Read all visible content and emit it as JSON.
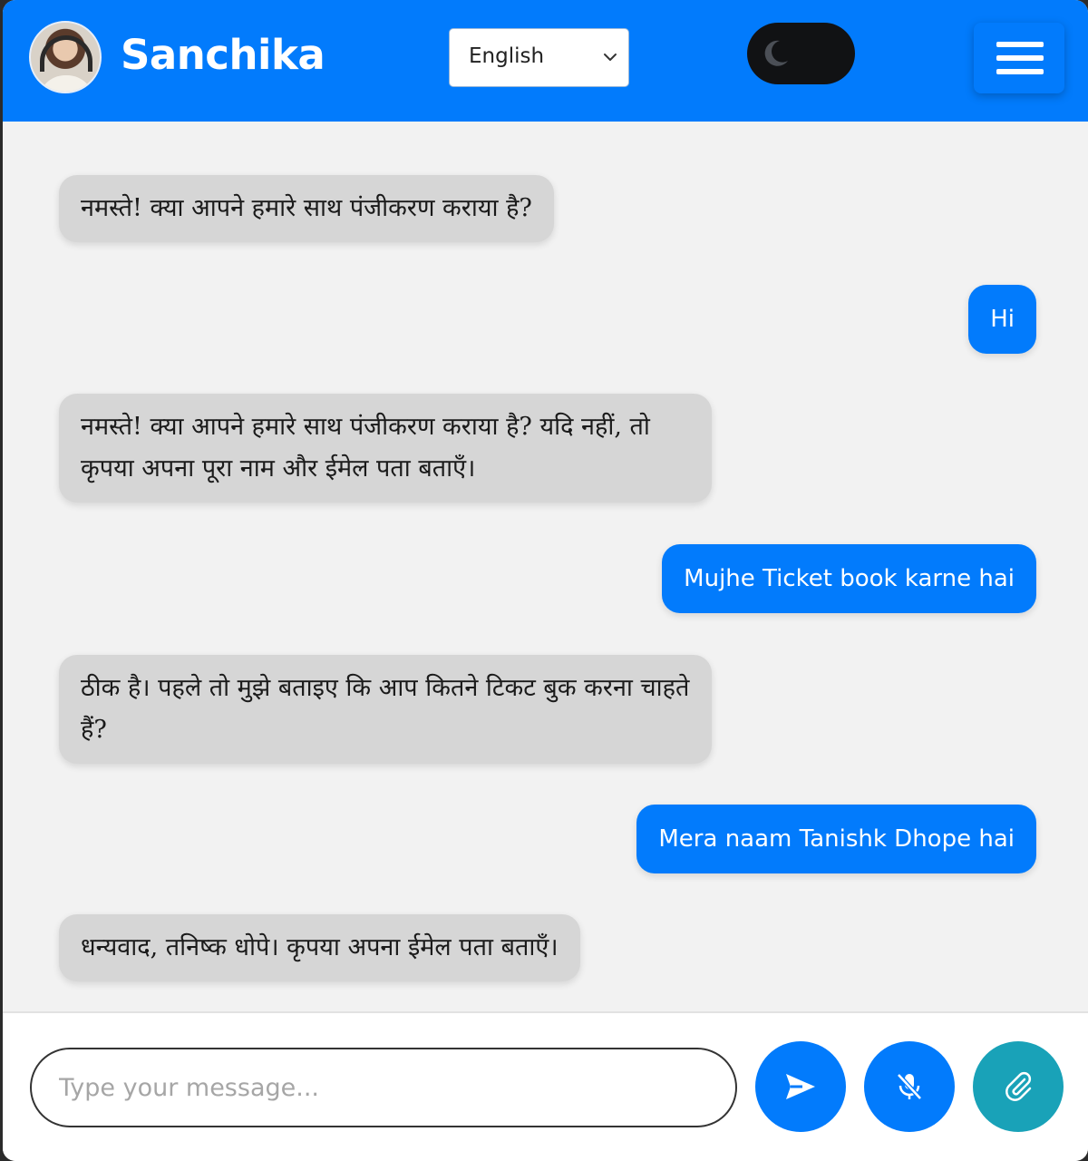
{
  "header": {
    "title": "Sanchika",
    "language_selected": "English",
    "theme_toggle_state": "dark",
    "colors": {
      "brand": "#027bfc",
      "toggle": "#111214"
    }
  },
  "messages": [
    {
      "sender": "bot",
      "text": "नमस्ते! क्या आपने हमारे साथ पंजीकरण कराया है?"
    },
    {
      "sender": "user",
      "text": "Hi"
    },
    {
      "sender": "bot",
      "text": "नमस्ते! क्या आपने हमारे साथ पंजीकरण कराया है? यदि नहीं, तो कृपया अपना पूरा नाम और ईमेल पता बताएँ।"
    },
    {
      "sender": "user",
      "text": "Mujhe Ticket book karne hai"
    },
    {
      "sender": "bot",
      "text": "ठीक है। पहले तो मुझे बताइए कि आप कितने टिकट बुक करना चाहते हैं?"
    },
    {
      "sender": "user",
      "text": "Mera naam Tanishk Dhope hai"
    },
    {
      "sender": "bot",
      "text": "धन्यवाद, तनिष्क धोपे। कृपया अपना ईमेल पता बताएँ।"
    }
  ],
  "composer": {
    "placeholder": "Type your message...",
    "value": "",
    "icons": [
      "send-icon",
      "mic-off-icon",
      "paperclip-icon"
    ],
    "colors": {
      "send": "#027bfc",
      "mic": "#027bfc",
      "attach": "#19a2b8"
    }
  }
}
